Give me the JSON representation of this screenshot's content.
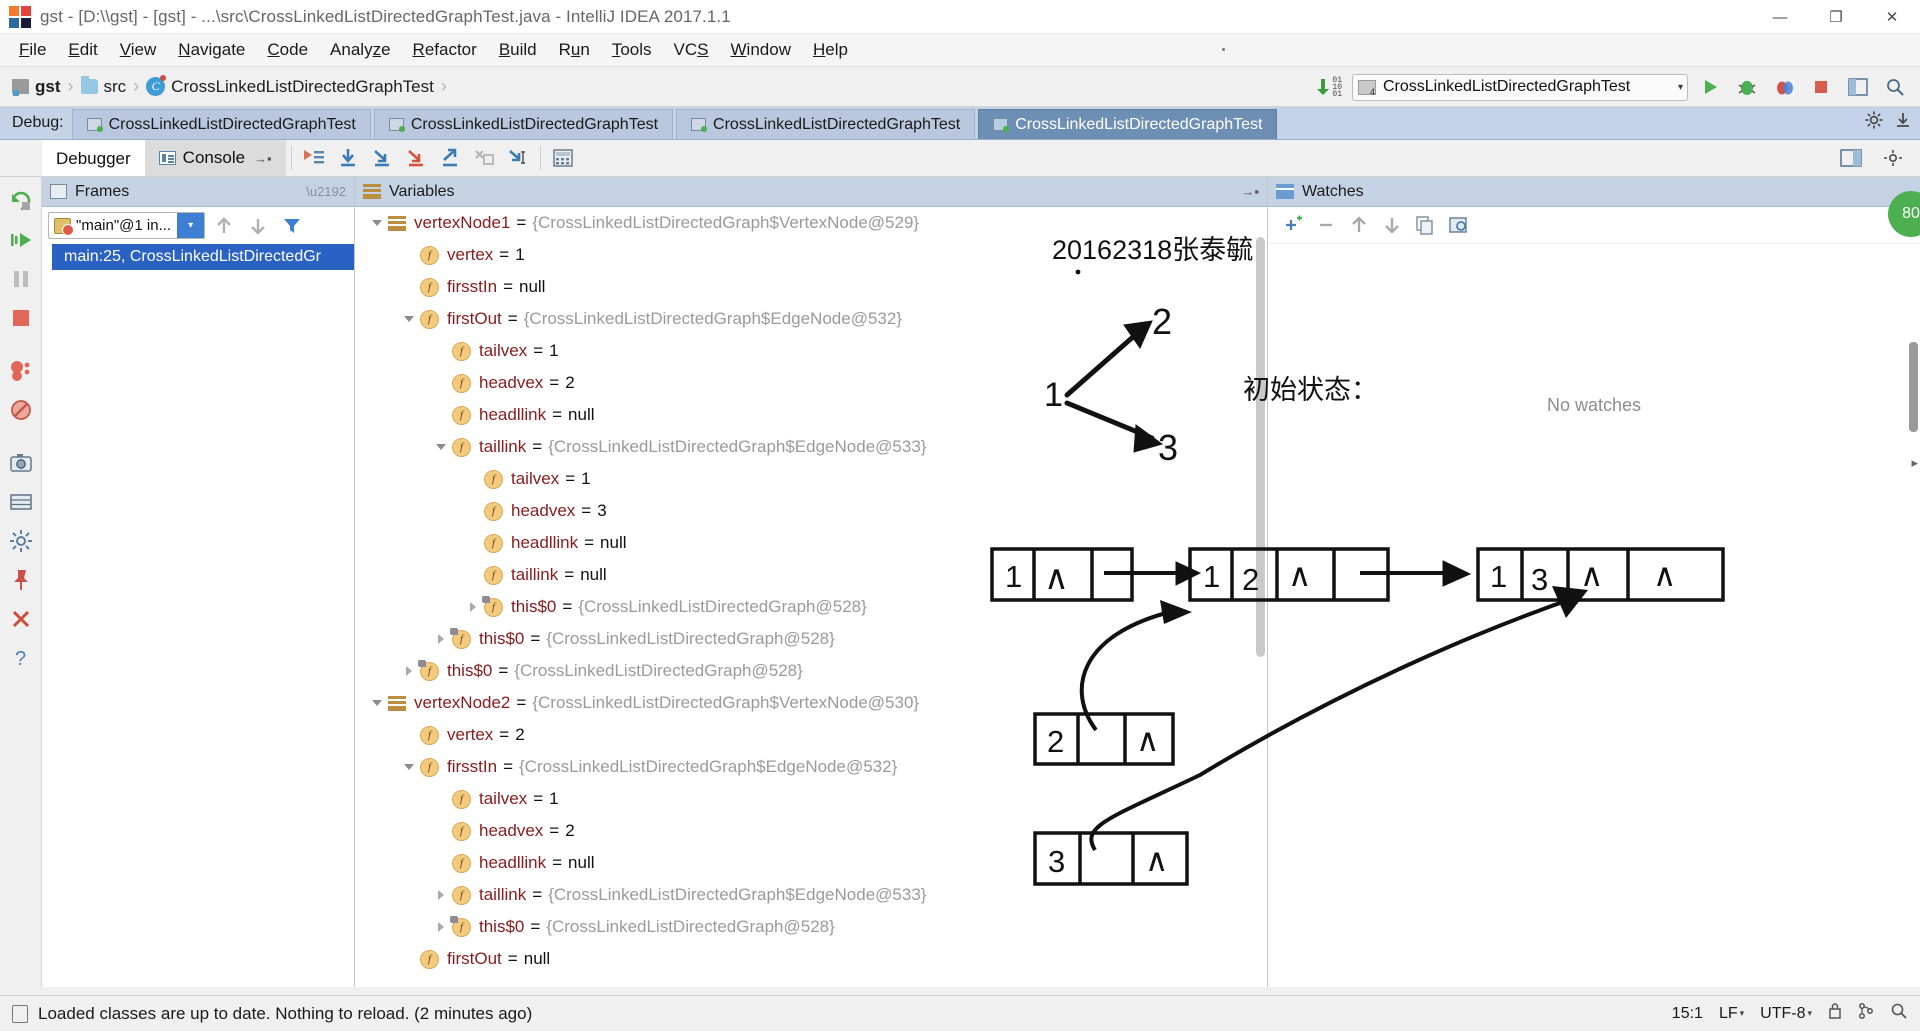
{
  "window": {
    "title": "gst - [D:\\\\gst] - [gst] - ...\\src\\CrossLinkedListDirectedGraphTest.java - IntelliJ IDEA 2017.1.1",
    "minimize_label": "—",
    "maximize_label": "❐",
    "close_label": "✕"
  },
  "menubar": {
    "items": [
      {
        "label": "File",
        "mnemonic": "F"
      },
      {
        "label": "Edit",
        "mnemonic": "E"
      },
      {
        "label": "View",
        "mnemonic": "V"
      },
      {
        "label": "Navigate",
        "mnemonic": "N"
      },
      {
        "label": "Code",
        "mnemonic": "C"
      },
      {
        "label": "Analyze",
        "mnemonic": "z"
      },
      {
        "label": "Refactor",
        "mnemonic": "R"
      },
      {
        "label": "Build",
        "mnemonic": "B"
      },
      {
        "label": "Run",
        "mnemonic": "u"
      },
      {
        "label": "Tools",
        "mnemonic": "T"
      },
      {
        "label": "VCS",
        "mnemonic": "S"
      },
      {
        "label": "Window",
        "mnemonic": "W"
      },
      {
        "label": "Help",
        "mnemonic": "H"
      }
    ]
  },
  "breadcrumb": {
    "project": "gst",
    "folder": "src",
    "class_initial": "C",
    "class_name": "CrossLinkedListDirectedGraphTest",
    "separator": "›"
  },
  "run_config": {
    "name": "CrossLinkedListDirectedGraphTest",
    "caret": "▾",
    "badge": "4"
  },
  "debug_strip": {
    "label": "Debug:",
    "tabs": [
      {
        "label": "CrossLinkedListDirectedGraphTest",
        "active": false
      },
      {
        "label": "CrossLinkedListDirectedGraphTest",
        "active": false
      },
      {
        "label": "CrossLinkedListDirectedGraphTest",
        "active": false
      },
      {
        "label": "CrossLinkedListDirectedGraphTest",
        "active": true
      }
    ]
  },
  "debugger_tabs": {
    "debugger": "Debugger",
    "console": "Console",
    "pin": "→▪"
  },
  "frames": {
    "title": "Frames",
    "thread": "\"main\"@1 in...",
    "caret": "▾",
    "selected_frame": "main:25, CrossLinkedListDirectedGr"
  },
  "variables": {
    "title": "Variables",
    "rows": [
      {
        "indent": 0,
        "tri": "down",
        "icon": "object",
        "name": "vertexNode1",
        "value": "{CrossLinkedListDirectedGraph$VertexNode@529}",
        "kind": "obj"
      },
      {
        "indent": 1,
        "tri": "none",
        "icon": "field",
        "name": "vertex",
        "value": "1",
        "kind": "num"
      },
      {
        "indent": 1,
        "tri": "none",
        "icon": "field",
        "name": "firsstIn",
        "value": "null",
        "kind": "nul"
      },
      {
        "indent": 1,
        "tri": "down",
        "icon": "field",
        "name": "firstOut",
        "value": "{CrossLinkedListDirectedGraph$EdgeNode@532}",
        "kind": "obj"
      },
      {
        "indent": 2,
        "tri": "none",
        "icon": "field",
        "name": "tailvex",
        "value": "1",
        "kind": "num"
      },
      {
        "indent": 2,
        "tri": "none",
        "icon": "field",
        "name": "headvex",
        "value": "2",
        "kind": "num"
      },
      {
        "indent": 2,
        "tri": "none",
        "icon": "field",
        "name": "headllink",
        "value": "null",
        "kind": "nul"
      },
      {
        "indent": 2,
        "tri": "down",
        "icon": "field",
        "name": "taillink",
        "value": "{CrossLinkedListDirectedGraph$EdgeNode@533}",
        "kind": "obj"
      },
      {
        "indent": 3,
        "tri": "none",
        "icon": "field",
        "name": "tailvex",
        "value": "1",
        "kind": "num"
      },
      {
        "indent": 3,
        "tri": "none",
        "icon": "field",
        "name": "headvex",
        "value": "3",
        "kind": "num"
      },
      {
        "indent": 3,
        "tri": "none",
        "icon": "field",
        "name": "headllink",
        "value": "null",
        "kind": "nul"
      },
      {
        "indent": 3,
        "tri": "none",
        "icon": "field",
        "name": "taillink",
        "value": "null",
        "kind": "nul"
      },
      {
        "indent": 3,
        "tri": "right",
        "icon": "field-shadow",
        "name": "this$0",
        "value": "{CrossLinkedListDirectedGraph@528}",
        "kind": "obj"
      },
      {
        "indent": 2,
        "tri": "right",
        "icon": "field-shadow",
        "name": "this$0",
        "value": "{CrossLinkedListDirectedGraph@528}",
        "kind": "obj"
      },
      {
        "indent": 1,
        "tri": "right",
        "icon": "field-shadow",
        "name": "this$0",
        "value": "{CrossLinkedListDirectedGraph@528}",
        "kind": "obj"
      },
      {
        "indent": 0,
        "tri": "down",
        "icon": "object",
        "name": "vertexNode2",
        "value": "{CrossLinkedListDirectedGraph$VertexNode@530}",
        "kind": "obj"
      },
      {
        "indent": 1,
        "tri": "none",
        "icon": "field",
        "name": "vertex",
        "value": "2",
        "kind": "num"
      },
      {
        "indent": 1,
        "tri": "down",
        "icon": "field",
        "name": "firsstIn",
        "value": "{CrossLinkedListDirectedGraph$EdgeNode@532}",
        "kind": "obj"
      },
      {
        "indent": 2,
        "tri": "none",
        "icon": "field",
        "name": "tailvex",
        "value": "1",
        "kind": "num"
      },
      {
        "indent": 2,
        "tri": "none",
        "icon": "field",
        "name": "headvex",
        "value": "2",
        "kind": "num"
      },
      {
        "indent": 2,
        "tri": "none",
        "icon": "field",
        "name": "headllink",
        "value": "null",
        "kind": "nul"
      },
      {
        "indent": 2,
        "tri": "right",
        "icon": "field",
        "name": "taillink",
        "value": "{CrossLinkedListDirectedGraph$EdgeNode@533}",
        "kind": "obj"
      },
      {
        "indent": 2,
        "tri": "right",
        "icon": "field-shadow",
        "name": "this$0",
        "value": "{CrossLinkedListDirectedGraph@528}",
        "kind": "obj"
      },
      {
        "indent": 1,
        "tri": "none",
        "icon": "field",
        "name": "firstOut",
        "value": "null",
        "kind": "nul"
      }
    ]
  },
  "watches": {
    "title": "Watches",
    "empty_text": "No watches"
  },
  "annotation": {
    "student_id": "20162318张泰毓",
    "state_label": "初始状态：",
    "graph_nodes": [
      "1",
      "2",
      "3"
    ],
    "caret_symbol": "∧",
    "rows": [
      {
        "id": "row1",
        "cells": [
          "1",
          "∧",
          ""
        ]
      },
      {
        "id": "row2",
        "cells": [
          "1",
          "2",
          "∧",
          ""
        ]
      },
      {
        "id": "row3",
        "cells": [
          "1",
          "3",
          "∧",
          "∧"
        ]
      },
      {
        "id": "row4",
        "cells": [
          "2",
          "",
          "∧"
        ]
      },
      {
        "id": "row5",
        "cells": [
          "3",
          "",
          "∧"
        ]
      }
    ]
  },
  "statusbar": {
    "message": "Loaded classes are up to date. Nothing to reload. (2 minutes ago)",
    "position": "15:1",
    "line_sep": "LF",
    "encoding": "UTF-8",
    "caret": "▾"
  },
  "colors": {
    "accent_blue": "#2a62c4",
    "tab_active": "#6e8fb4",
    "panel_header": "#c5d2e4",
    "var_name": "#871c1c",
    "var_object": "#9a9a9a",
    "green": "#4caf50",
    "red": "#cf4b3d"
  }
}
